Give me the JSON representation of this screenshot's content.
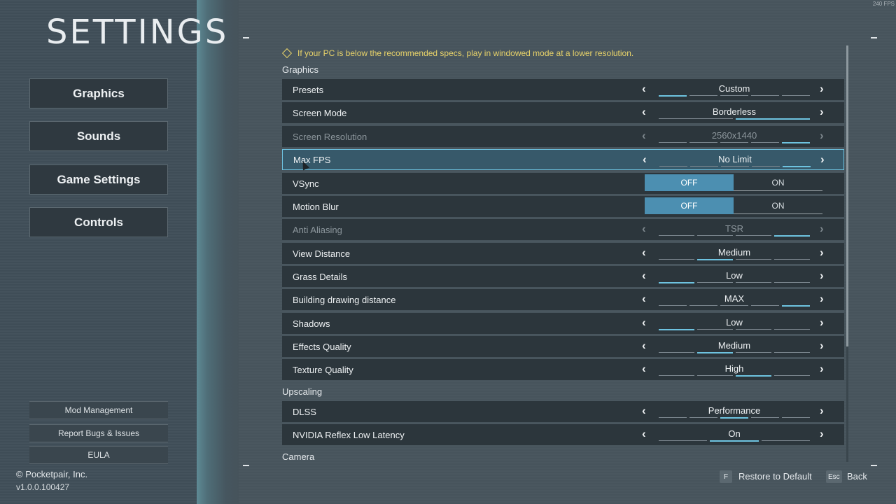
{
  "title": "SETTINGS",
  "fps_counter": "240 FPS",
  "nav": [
    "Graphics",
    "Sounds",
    "Game Settings",
    "Controls"
  ],
  "bottom_links": [
    "Mod Management",
    "Report Bugs & Issues",
    "EULA"
  ],
  "copyright": "© Pocketpair, Inc.",
  "version": "v1.0.0.100427",
  "warning": "If your PC is below the recommended specs, play in windowed mode at a lower resolution.",
  "sections": {
    "graphics": "Graphics",
    "upscaling": "Upscaling",
    "camera": "Camera"
  },
  "rows": [
    {
      "label": "Presets",
      "value": "Custom",
      "segments": 5,
      "active": 0
    },
    {
      "label": "Screen Mode",
      "value": "Borderless",
      "segments": 2,
      "active": 1
    },
    {
      "label": "Screen Resolution",
      "value": "2560x1440",
      "segments": 5,
      "active": 4
    },
    {
      "label": "Max FPS",
      "value": "No Limit",
      "segments": 5,
      "active": 4
    },
    {
      "label": "VSync",
      "toggle": [
        "OFF",
        "ON"
      ]
    },
    {
      "label": "Motion Blur",
      "toggle": [
        "OFF",
        "ON"
      ]
    },
    {
      "label": "Anti Aliasing",
      "value": "TSR",
      "segments": 4,
      "active": 3
    },
    {
      "label": "View Distance",
      "value": "Medium",
      "segments": 4,
      "active": 1
    },
    {
      "label": "Grass Details",
      "value": "Low",
      "segments": 4,
      "active": 0
    },
    {
      "label": "Building drawing distance",
      "value": "MAX",
      "segments": 5,
      "active": 4
    },
    {
      "label": "Shadows",
      "value": "Low",
      "segments": 4,
      "active": 0
    },
    {
      "label": "Effects Quality",
      "value": "Medium",
      "segments": 4,
      "active": 1
    },
    {
      "label": "Texture Quality",
      "value": "High",
      "segments": 4,
      "active": 2
    },
    {
      "label": "DLSS",
      "value": "Performance",
      "segments": 5,
      "active": 2
    },
    {
      "label": "NVIDIA Reflex Low Latency",
      "value": "On",
      "segments": 3,
      "active": 1
    }
  ],
  "footer": {
    "restore_key": "F",
    "restore_label": "Restore to Default",
    "back_key": "Esc",
    "back_label": "Back"
  },
  "colors": {
    "accent": "#6ec3e0",
    "toggle_active": "#4c8fb1",
    "warning": "#e8d36a"
  }
}
